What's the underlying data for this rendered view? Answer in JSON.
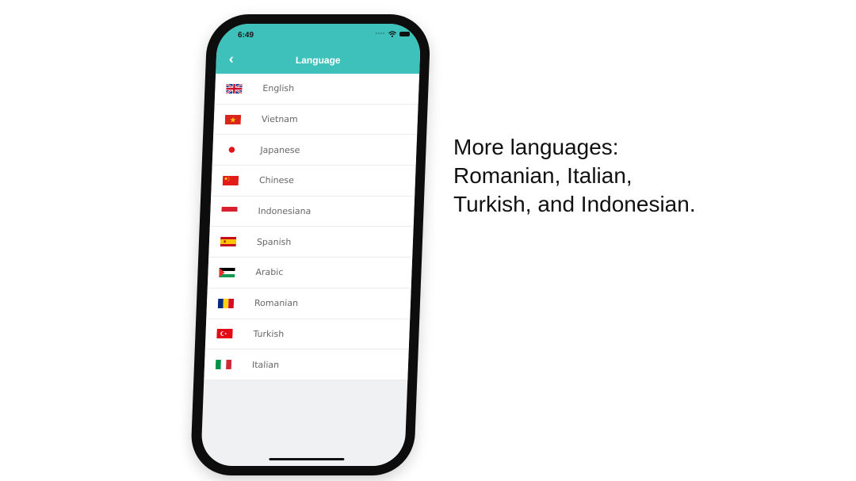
{
  "status_bar": {
    "time": "6:49"
  },
  "header": {
    "title": "Language",
    "back_icon": "chevron-left-icon"
  },
  "languages": [
    {
      "label": "English",
      "flag": "uk-flag-icon"
    },
    {
      "label": "Vietnam",
      "flag": "vietnam-flag-icon"
    },
    {
      "label": "Japanese",
      "flag": "japan-flag-icon"
    },
    {
      "label": "Chinese",
      "flag": "china-flag-icon"
    },
    {
      "label": "Indonesiana",
      "flag": "indonesia-flag-icon"
    },
    {
      "label": "Spanish",
      "flag": "spain-flag-icon"
    },
    {
      "label": "Arabic",
      "flag": "palestine-flag-icon"
    },
    {
      "label": "Romanian",
      "flag": "romania-flag-icon"
    },
    {
      "label": "Turkish",
      "flag": "turkey-flag-icon"
    },
    {
      "label": "Italian",
      "flag": "italy-flag-icon"
    }
  ],
  "caption": {
    "lines": [
      "More languages:",
      "Romanian, Italian,",
      "Turkish, and Indonesian."
    ]
  },
  "colors": {
    "header": "#3fc1bb",
    "background": "#f0f1f3"
  }
}
